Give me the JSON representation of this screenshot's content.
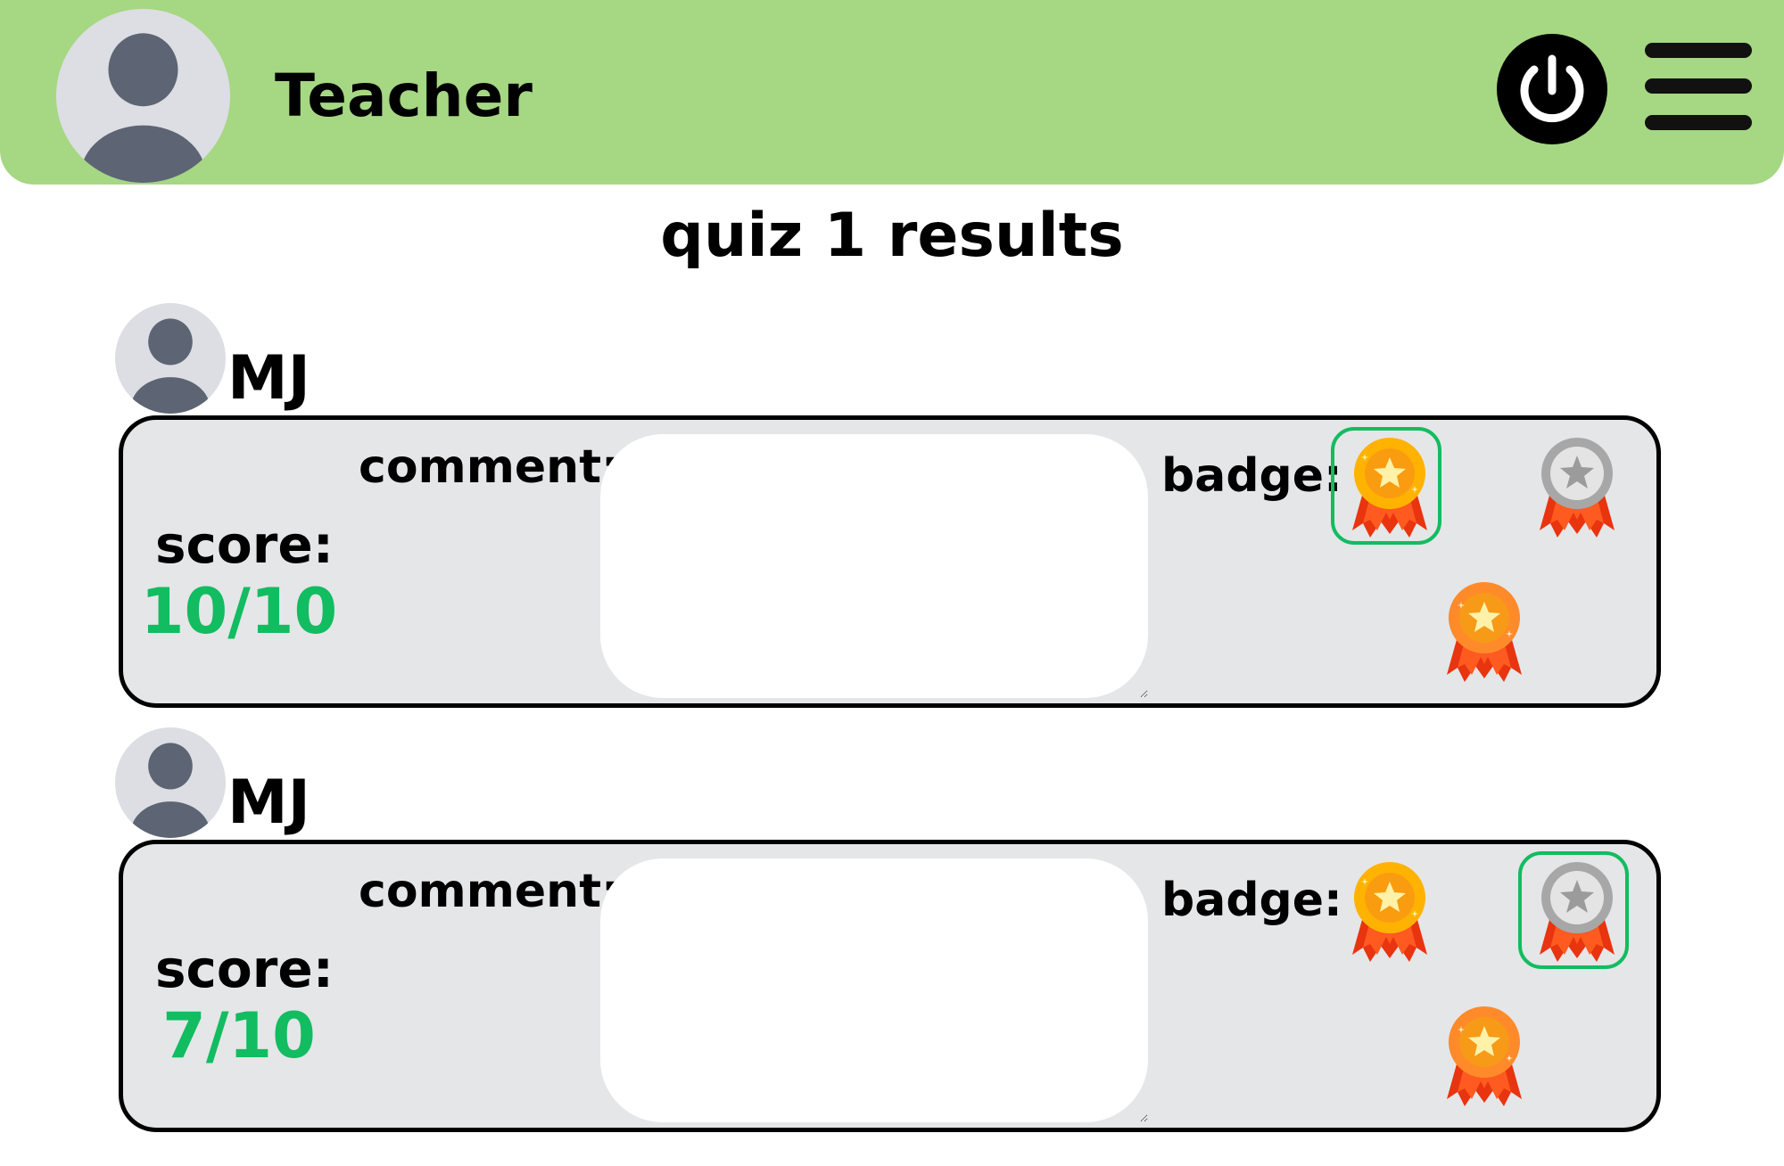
{
  "header": {
    "title": "Teacher",
    "avatar_icon": "user-avatar-icon",
    "power_icon": "power-icon",
    "menu_icon": "hamburger-menu-icon",
    "background_color": "#a6d783"
  },
  "page_title": "quiz 1 results",
  "students": [
    {
      "name": "MJ",
      "avatar_icon": "user-avatar-icon",
      "score_label": "score:",
      "score": "10/10",
      "comment_label": "comment:",
      "comment": "",
      "badge_label": "badge:",
      "badges": [
        "gold-medal-icon",
        "silver-medal-icon",
        "bronze-medal-icon"
      ],
      "selected_badge": "gold"
    },
    {
      "name": "MJ",
      "avatar_icon": "user-avatar-icon",
      "score_label": "score:",
      "score": "7/10",
      "comment_label": "comment:",
      "comment": "",
      "badge_label": "badge:",
      "badges": [
        "gold-medal-icon",
        "silver-medal-icon",
        "bronze-medal-icon"
      ],
      "selected_badge": "silver"
    }
  ],
  "colors": {
    "score": "#12bc60",
    "selected_outline": "#12bc60",
    "card_background": "#e5e6e8"
  }
}
